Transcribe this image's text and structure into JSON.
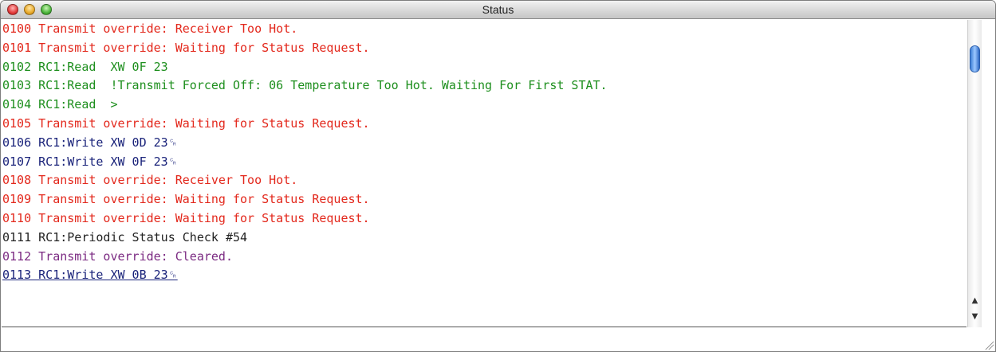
{
  "window": {
    "title": "Status"
  },
  "log": {
    "lines": [
      {
        "text": "0100 Transmit override: Receiver Too Hot.",
        "color": "red"
      },
      {
        "text": "0101 Transmit override: Waiting for Status Request.",
        "color": "red"
      },
      {
        "text": "0102 RC1:Read  XW 0F 23",
        "color": "green"
      },
      {
        "text": "0103 RC1:Read  !Transmit Forced Off: 06 Temperature Too Hot. Waiting For First STAT.",
        "color": "green"
      },
      {
        "text": "0104 RC1:Read  >",
        "color": "green"
      },
      {
        "text": "0105 Transmit override: Waiting for Status Request.",
        "color": "red"
      },
      {
        "text": "0106 RC1:Write XW 0D 23␍",
        "color": "blue"
      },
      {
        "text": "0107 RC1:Write XW 0F 23␍",
        "color": "blue"
      },
      {
        "text": "0108 Transmit override: Receiver Too Hot.",
        "color": "red"
      },
      {
        "text": "0109 Transmit override: Waiting for Status Request.",
        "color": "red"
      },
      {
        "text": "0110 Transmit override: Waiting for Status Request.",
        "color": "red"
      },
      {
        "text": "0111 RC1:Periodic Status Check #54",
        "color": "black"
      },
      {
        "text": "0112 Transmit override: Cleared.",
        "color": "purple"
      },
      {
        "text": "0113 RC1:Write XW 0B 23␍",
        "color": "blue"
      }
    ]
  },
  "colors": {
    "red": "#e3281c",
    "green": "#1e8f1e",
    "blue": "#1a237a",
    "black": "#222222",
    "purple": "#7b2a82",
    "scroll_thumb": "#3d7fd6"
  },
  "icons": {
    "close": "close-icon",
    "minimize": "minimize-icon",
    "zoom": "zoom-icon",
    "scroll_up": "scroll-up-arrow-icon",
    "scroll_down": "scroll-down-arrow-icon",
    "resize": "resize-grip-icon"
  },
  "scroll": {
    "position_fraction": 0.05
  },
  "input": {
    "value": ""
  }
}
